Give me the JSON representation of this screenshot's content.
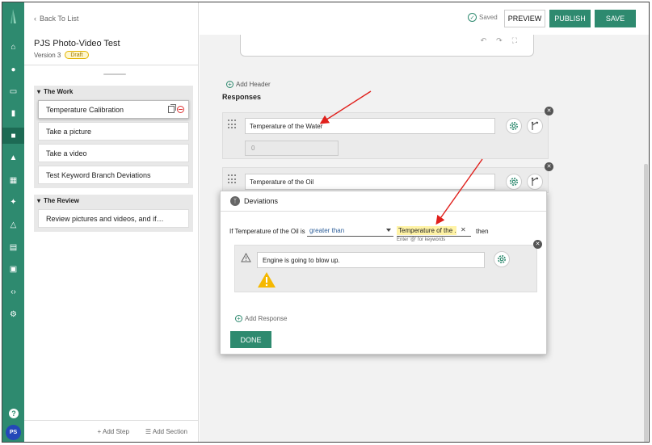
{
  "topbar": {
    "back_label": "Back To List",
    "saved_label": "Saved",
    "preview_label": "PREVIEW",
    "publish_label": "PUBLISH",
    "save_label": "SAVE"
  },
  "outline": {
    "doc_title": "PJS Photo-Video Test",
    "version_label": "Version 3",
    "status_badge": "Draft",
    "sections": [
      {
        "name": "The Work",
        "steps": [
          "Temperature Calibration",
          "Take a picture",
          "Take a video",
          "Test Keyword Branch Deviations"
        ]
      },
      {
        "name": "The Review",
        "steps": [
          "Review pictures and videos, and if…"
        ]
      }
    ],
    "add_step_label": "Add Step",
    "add_section_label": "Add Section"
  },
  "rail": {
    "icons": [
      "home-icon",
      "chat-icon",
      "message-icon",
      "clipboard-icon",
      "procedure-icon",
      "box-icon",
      "grid-icon",
      "network-icon",
      "tree-icon",
      "id-card-icon",
      "report-icon",
      "code-icon",
      "gear-icon"
    ],
    "avatar_initials": "PS",
    "help_label": "?"
  },
  "main": {
    "add_header_label": "Add Header",
    "responses_label": "Responses",
    "response_1": {
      "value": "Temperature of the Water",
      "numeric_value": "0"
    },
    "response_2": {
      "value": "Temperature of the Oil"
    }
  },
  "deviations": {
    "title": "Deviations",
    "condition_prefix": "If Temperature of the Oil is",
    "operator": "greater than",
    "keyword_chip": "Temperature of the ...",
    "keyword_hint": "Enter '@' for keywords",
    "then_label": "then",
    "message": "Engine is going to blow up.",
    "add_response_label": "Add Response",
    "done_label": "DONE"
  },
  "colors": {
    "brand_green": "#2e8a6f",
    "warning_yellow": "#f5b800",
    "annotation_red": "#e0201c"
  }
}
